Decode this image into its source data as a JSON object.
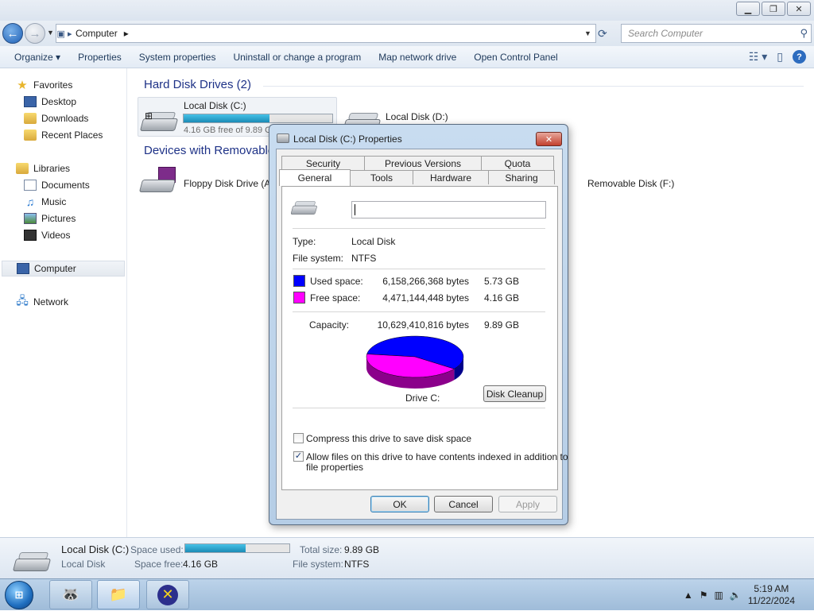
{
  "address": {
    "crumb": "Computer",
    "search_placeholder": "Search Computer"
  },
  "commands": [
    "Organize ▾",
    "Properties",
    "System properties",
    "Uninstall or change a program",
    "Map network drive",
    "Open Control Panel"
  ],
  "nav": {
    "favorites": "Favorites",
    "desktop": "Desktop",
    "downloads": "Downloads",
    "recent": "Recent Places",
    "libraries": "Libraries",
    "documents": "Documents",
    "music": "Music",
    "pictures": "Pictures",
    "videos": "Videos",
    "computer": "Computer",
    "network": "Network"
  },
  "groups": {
    "hdd": "Hard Disk Drives (2)",
    "removable": "Devices with Removable"
  },
  "drives": {
    "c_name": "Local Disk (C:)",
    "c_sub": "4.16 GB free of 9.89 GB",
    "c_used_fraction": 0.58,
    "d_name": "Local Disk (D:)",
    "floppy": "Floppy Disk Drive (A",
    "removable_f": "Removable Disk (F:)"
  },
  "details": {
    "name": "Local Disk (C:)",
    "type": "Local Disk",
    "space_used_label": "Space used:",
    "space_free_label": "Space free:",
    "space_free": "4.16 GB",
    "total_label": "Total size:",
    "total": "9.89 GB",
    "fs_label": "File system:",
    "fs": "NTFS"
  },
  "taskbar": {
    "time": "5:19 AM",
    "date": "11/22/2024"
  },
  "dialog": {
    "title": "Local Disk (C:) Properties",
    "tabs_top": [
      "Security",
      "Previous Versions",
      "Quota"
    ],
    "tabs_bottom": [
      "General",
      "Tools",
      "Hardware",
      "Sharing"
    ],
    "type_label": "Type:",
    "type_value": "Local Disk",
    "fs_label": "File system:",
    "fs_value": "NTFS",
    "used_label": "Used space:",
    "used_bytes": "6,158,266,368 bytes",
    "used_gb": "5.73 GB",
    "free_label": "Free space:",
    "free_bytes": "4,471,144,448 bytes",
    "free_gb": "4.16 GB",
    "capacity_label": "Capacity:",
    "capacity_bytes": "10,629,410,816 bytes",
    "capacity_gb": "9.89 GB",
    "drive_label": "Drive C:",
    "cleanup": "Disk Cleanup",
    "compress": "Compress this drive to save disk space",
    "index_line1": "Allow files on this drive to have contents indexed in addition to",
    "index_line2": "file properties",
    "ok": "OK",
    "cancel": "Cancel",
    "apply": "Apply",
    "used_color": "#0000ff",
    "free_color": "#ff00ff",
    "used_fraction": 0.579
  }
}
